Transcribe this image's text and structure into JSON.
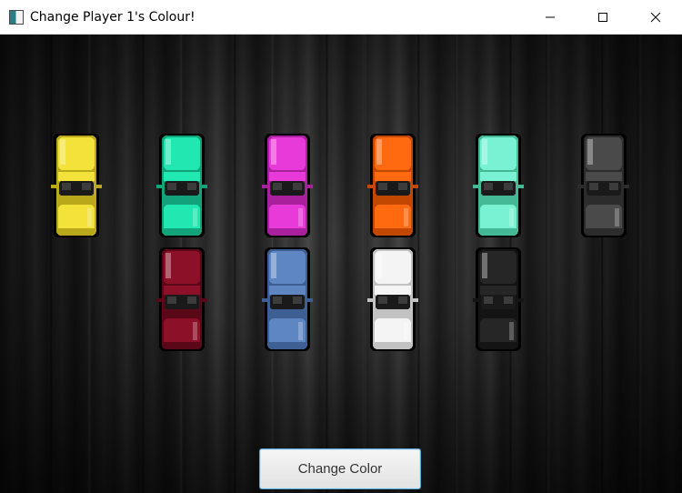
{
  "window": {
    "title": "Change Player 1's Colour!",
    "app_icon": "java-app-icon",
    "controls": [
      "minimize-icon",
      "maximize-icon",
      "close-icon"
    ]
  },
  "cars": [
    {
      "name": "car-yellow",
      "color": "#f2e23a",
      "shade": "#b9a81a"
    },
    {
      "name": "car-turquoise",
      "color": "#20e8b0",
      "shade": "#12a37b"
    },
    {
      "name": "car-magenta",
      "color": "#e83ad8",
      "shade": "#a8209b"
    },
    {
      "name": "car-orange",
      "color": "#ff6a10",
      "shade": "#c24700"
    },
    {
      "name": "car-aquamarine",
      "color": "#78f2d2",
      "shade": "#45b896"
    },
    {
      "name": "car-dark-grey",
      "color": "#4a4a4a",
      "shade": "#2c2c2c"
    },
    {
      "name": "car-crimson",
      "color": "#8c1028",
      "shade": "#5a0818"
    },
    {
      "name": "car-steel-blue",
      "color": "#5e86c2",
      "shade": "#3d5f93"
    },
    {
      "name": "car-white",
      "color": "#f4f4f4",
      "shade": "#c2c2c2"
    },
    {
      "name": "car-black",
      "color": "#262626",
      "shade": "#141414"
    }
  ],
  "actions": {
    "change_color_label": "Change Color"
  },
  "colors": {
    "button_border": "#5aa7d6",
    "background": "#3a3a3a"
  }
}
